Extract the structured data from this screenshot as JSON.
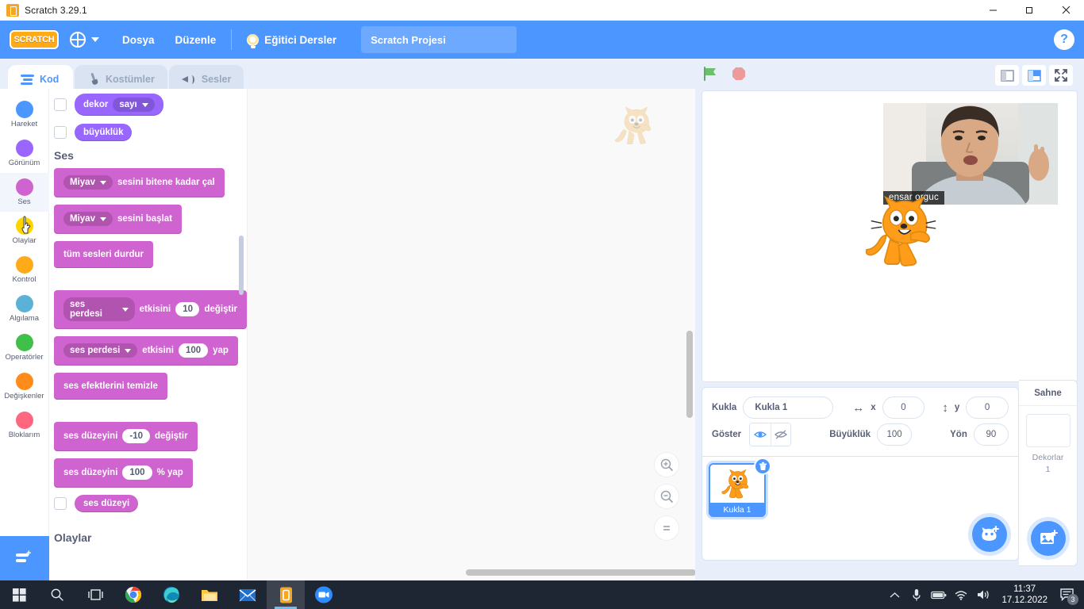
{
  "window": {
    "title": "Scratch 3.29.1",
    "app_icon": "scratch-app-icon",
    "minimize": "—",
    "maximize": "❐",
    "close": "✕"
  },
  "menubar": {
    "logo_text": "SCRATCH",
    "language_icon": "globe-icon",
    "items": [
      {
        "label": "Dosya"
      },
      {
        "label": "Düzenle"
      }
    ],
    "tutorials_label": "Eğitici Dersler",
    "tutorials_icon": "lightbulb-icon",
    "project_name": "Scratch Projesi",
    "help_label": "?",
    "accent_color": "#4c97ff"
  },
  "tabs": [
    {
      "label": "Kod",
      "icon": "code-icon",
      "active": true
    },
    {
      "label": "Kostümler",
      "icon": "brush-icon",
      "active": false
    },
    {
      "label": "Sesler",
      "icon": "speaker-icon",
      "active": false
    }
  ],
  "categories": [
    {
      "label": "Hareket",
      "color": "#4c97ff",
      "selected": false
    },
    {
      "label": "Görünüm",
      "color": "#9966ff",
      "selected": false
    },
    {
      "label": "Ses",
      "color": "#cf63cf",
      "selected": true
    },
    {
      "label": "Olaylar",
      "color": "#ffd500",
      "selected": false
    },
    {
      "label": "Kontrol",
      "color": "#ffab19",
      "selected": false
    },
    {
      "label": "Algılama",
      "color": "#5cb1d6",
      "selected": false
    },
    {
      "label": "Operatörler",
      "color": "#40bf4a",
      "selected": false
    },
    {
      "label": "Değişkenler",
      "color": "#ff8c1a",
      "selected": false
    },
    {
      "label": "Bloklarım",
      "color": "#ff6680",
      "selected": false
    }
  ],
  "extension_button": {
    "icon": "add-extension-icon"
  },
  "palette": {
    "looks_reporters": [
      {
        "label": "dekor",
        "dropdown": "sayı",
        "checked": false,
        "color": "#9966ff"
      },
      {
        "label": "büyüklük",
        "checked": false,
        "color": "#9966ff"
      }
    ],
    "sound_header": "Ses",
    "sound_blocks": [
      {
        "kind": "stack",
        "dropdown": "Miyav",
        "text": "sesini bitene kadar çal"
      },
      {
        "kind": "stack",
        "dropdown": "Miyav",
        "text": "sesini başlat"
      },
      {
        "kind": "stack",
        "text": "tüm sesleri durdur"
      },
      {
        "kind": "stack",
        "dropdown": "ses perdesi",
        "text": "etkisini",
        "value": "10",
        "suffix": "değiştir"
      },
      {
        "kind": "stack",
        "dropdown": "ses perdesi",
        "text": "etkisini",
        "value": "100",
        "suffix": "yap"
      },
      {
        "kind": "stack",
        "text": "ses efektlerini temizle"
      },
      {
        "kind": "stack",
        "text": "ses düzeyini",
        "value": "-10",
        "suffix": "değiştir"
      },
      {
        "kind": "stack",
        "text": "ses düzeyini",
        "value": "100",
        "suffix": "% yap"
      },
      {
        "kind": "reporter",
        "text": "ses düzeyi",
        "checked": false
      }
    ],
    "next_header": "Olaylar",
    "sound_color": "#cf63cf"
  },
  "canvas": {
    "watermark_icon": "scratch-cat-watermark",
    "zoom_in": "zoom-in-icon",
    "zoom_out": "zoom-out-icon",
    "zoom_reset": "zoom-reset-icon"
  },
  "stage_controls": {
    "green_flag": "green-flag-icon",
    "stop": "stop-sign-icon",
    "small_stage": "small-stage-icon",
    "large_stage": "large-stage-icon",
    "fullscreen": "fullscreen-icon",
    "selected_size": "large"
  },
  "stage": {
    "video_name": "ensar orguc",
    "sprite_icon": "scratch-cat-sprite"
  },
  "sprite_info": {
    "sprite_label": "Kukla",
    "sprite_name": "Kukla 1",
    "x_label": "x",
    "x_value": "0",
    "y_label": "y",
    "y_value": "0",
    "show_label": "Göster",
    "show_icon": "eye-visible-icon",
    "hide_icon": "eye-hidden-icon",
    "size_label": "Büyüklük",
    "size_value": "100",
    "direction_label": "Yön",
    "direction_value": "90"
  },
  "sprite_list": {
    "items": [
      {
        "name": "Kukla 1",
        "selected": true,
        "delete_icon": "trash-icon"
      }
    ],
    "add_sprite_icon": "add-sprite-icon"
  },
  "stage_panel": {
    "title": "Sahne",
    "backdrops_label": "Dekorlar",
    "backdrops_count": "1",
    "add_backdrop_icon": "add-backdrop-icon"
  },
  "taskbar": {
    "items": [
      {
        "name": "start-button",
        "icon": "windows-logo-icon"
      },
      {
        "name": "search-button",
        "icon": "search-icon"
      },
      {
        "name": "task-view-button",
        "icon": "task-view-icon"
      },
      {
        "name": "chrome-button",
        "icon": "chrome-icon"
      },
      {
        "name": "edge-button",
        "icon": "edge-icon"
      },
      {
        "name": "file-explorer-button",
        "icon": "folder-icon"
      },
      {
        "name": "mail-button",
        "icon": "mail-icon"
      },
      {
        "name": "scratch-button",
        "icon": "scratch-app-icon",
        "active": true
      },
      {
        "name": "zoom-button",
        "icon": "zoom-app-icon",
        "label": "zoom"
      }
    ],
    "tray": {
      "chevron": "chevron-up-icon",
      "microphone": "microphone-icon",
      "battery": "battery-icon",
      "wifi": "wifi-icon",
      "volume": "volume-icon",
      "time": "11:37",
      "date": "17.12.2022",
      "notification_icon": "notification-icon",
      "notification_count": "3"
    }
  }
}
